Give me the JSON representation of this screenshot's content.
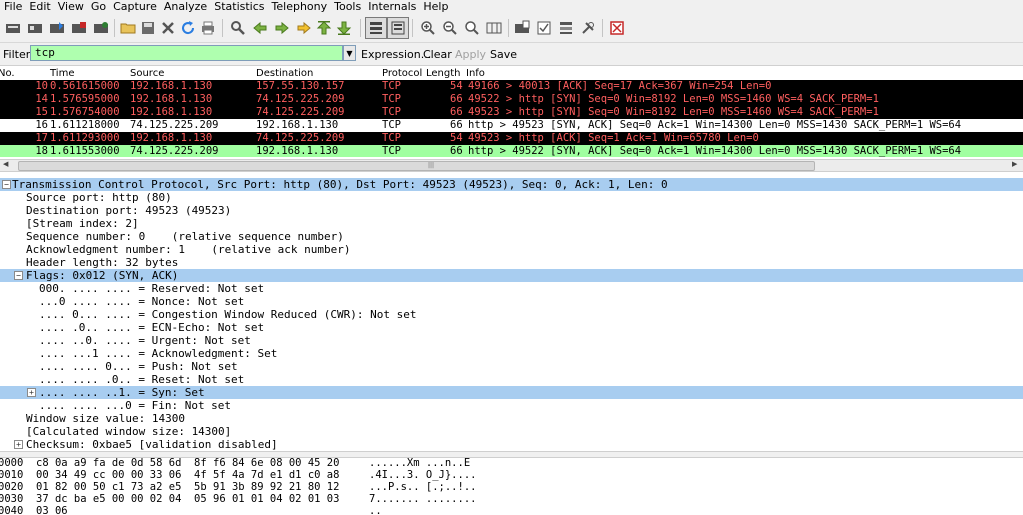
{
  "menu": [
    "File",
    "Edit",
    "View",
    "Go",
    "Capture",
    "Analyze",
    "Statistics",
    "Telephony",
    "Tools",
    "Internals",
    "Help"
  ],
  "filter": {
    "label": "Filter:",
    "value": "tcp",
    "expression": "Expression...",
    "clear": "Clear",
    "apply": "Apply",
    "save": "Save"
  },
  "columns": {
    "no": "No.",
    "time": "Time",
    "source": "Source",
    "destination": "Destination",
    "protocol": "Protocol",
    "length": "Length",
    "info": "Info"
  },
  "colors": {
    "black_row_bg": "#000000",
    "black_row_fg": "#ff5f5f",
    "white_row_bg": "#ffffff",
    "green_row_bg": "#a0ffa0",
    "selected_bg": "#a8cdf0",
    "filter_bg": "#afffaf"
  },
  "packets": [
    {
      "no": "10",
      "time": "0.561615000",
      "source": "192.168.1.130",
      "destination": "157.55.130.157",
      "protocol": "TCP",
      "length": "54",
      "info": "49166 > 40013 [ACK] Seq=17 Ack=367 Win=254 Len=0",
      "style": "black"
    },
    {
      "no": "14",
      "time": "1.576595000",
      "source": "192.168.1.130",
      "destination": "74.125.225.209",
      "protocol": "TCP",
      "length": "66",
      "info": "49522 > http [SYN] Seq=0 Win=8192 Len=0 MSS=1460 WS=4 SACK_PERM=1",
      "style": "black"
    },
    {
      "no": "15",
      "time": "1.576754000",
      "source": "192.168.1.130",
      "destination": "74.125.225.209",
      "protocol": "TCP",
      "length": "66",
      "info": "49523 > http [SYN] Seq=0 Win=8192 Len=0 MSS=1460 WS=4 SACK_PERM=1",
      "style": "black"
    },
    {
      "no": "16",
      "time": "1.611218000",
      "source": "74.125.225.209",
      "destination": "192.168.1.130",
      "protocol": "TCP",
      "length": "66",
      "info": "http > 49523 [SYN, ACK] Seq=0 Ack=1 Win=14300 Len=0 MSS=1430 SACK_PERM=1 WS=64",
      "style": "white"
    },
    {
      "no": "17",
      "time": "1.611293000",
      "source": "192.168.1.130",
      "destination": "74.125.225.209",
      "protocol": "TCP",
      "length": "54",
      "info": "49523 > http [ACK] Seq=1 Ack=1 Win=65780 Len=0",
      "style": "black"
    },
    {
      "no": "18",
      "time": "1.611553000",
      "source": "74.125.225.209",
      "destination": "192.168.1.130",
      "protocol": "TCP",
      "length": "66",
      "info": "http > 49522 [SYN, ACK] Seq=0 Ack=1 Win=14300 Len=0 MSS=1430 SACK_PERM=1 WS=64",
      "style": "green"
    }
  ],
  "details": [
    {
      "indent": 0,
      "expander": "minus",
      "text": "Transmission Control Protocol, Src Port: http (80), Dst Port: 49523 (49523), Seq: 0, Ack: 1, Len: 0",
      "style": "sel"
    },
    {
      "indent": 1,
      "expander": "",
      "text": "Source port: http (80)",
      "style": ""
    },
    {
      "indent": 1,
      "expander": "",
      "text": "Destination port: 49523 (49523)",
      "style": ""
    },
    {
      "indent": 1,
      "expander": "",
      "text": "[Stream index: 2]",
      "style": ""
    },
    {
      "indent": 1,
      "expander": "",
      "text": "Sequence number: 0    (relative sequence number)",
      "style": ""
    },
    {
      "indent": 1,
      "expander": "",
      "text": "Acknowledgment number: 1    (relative ack number)",
      "style": ""
    },
    {
      "indent": 1,
      "expander": "",
      "text": "Header length: 32 bytes",
      "style": ""
    },
    {
      "indent": 1,
      "expander": "minus",
      "text": "Flags: 0x012 (SYN, ACK)",
      "style": "sel"
    },
    {
      "indent": 2,
      "expander": "",
      "text": "000. .... .... = Reserved: Not set",
      "style": ""
    },
    {
      "indent": 2,
      "expander": "",
      "text": "...0 .... .... = Nonce: Not set",
      "style": ""
    },
    {
      "indent": 2,
      "expander": "",
      "text": ".... 0... .... = Congestion Window Reduced (CWR): Not set",
      "style": ""
    },
    {
      "indent": 2,
      "expander": "",
      "text": ".... .0.. .... = ECN-Echo: Not set",
      "style": ""
    },
    {
      "indent": 2,
      "expander": "",
      "text": ".... ..0. .... = Urgent: Not set",
      "style": ""
    },
    {
      "indent": 2,
      "expander": "",
      "text": ".... ...1 .... = Acknowledgment: Set",
      "style": ""
    },
    {
      "indent": 2,
      "expander": "",
      "text": ".... .... 0... = Push: Not set",
      "style": ""
    },
    {
      "indent": 2,
      "expander": "",
      "text": ".... .... .0.. = Reset: Not set",
      "style": ""
    },
    {
      "indent": 2,
      "expander": "plus",
      "text": ".... .... ..1. = Syn: Set",
      "style": "sel"
    },
    {
      "indent": 2,
      "expander": "",
      "text": ".... .... ...0 = Fin: Not set",
      "style": ""
    },
    {
      "indent": 1,
      "expander": "",
      "text": "Window size value: 14300",
      "style": ""
    },
    {
      "indent": 1,
      "expander": "",
      "text": "[Calculated window size: 14300]",
      "style": ""
    },
    {
      "indent": 1,
      "expander": "plus",
      "text": "Checksum: 0xbae5 [validation disabled]",
      "style": ""
    }
  ],
  "hex": [
    {
      "offset": "0000",
      "bytes": "c8 0a a9 fa de 0d 58 6d  8f f6 84 6e 08 00 45 20",
      "ascii": "......Xm ...n..E "
    },
    {
      "offset": "0010",
      "bytes": "00 34 49 cc 00 00 33 06  4f 5f 4a 7d e1 d1 c0 a8",
      "ascii": ".4I...3. O_J}...."
    },
    {
      "offset": "0020",
      "bytes": "01 82 00 50 c1 73 a2 e5  5b 91 3b 89 92 21 80 12",
      "ascii": "...P.s.. [.;..!.."
    },
    {
      "offset": "0030",
      "bytes": "37 dc ba e5 00 00 02 04  05 96 01 01 04 02 01 03",
      "ascii": "7....... ........"
    },
    {
      "offset": "0040",
      "bytes": "03 06",
      "ascii": ".."
    }
  ],
  "toolbar_icons": [
    "interface-list-icon",
    "capture-options-icon",
    "start-capture-icon",
    "stop-capture-icon",
    "restart-capture-icon",
    "open-file-icon",
    "save-file-icon",
    "close-file-icon",
    "reload-icon",
    "print-icon",
    "find-packet-icon",
    "go-back-icon",
    "go-forward-icon",
    "go-to-packet-icon",
    "go-first-icon",
    "go-last-icon",
    "colorize-icon",
    "auto-scroll-icon",
    "zoom-in-icon",
    "zoom-out-icon",
    "zoom-normal-icon",
    "resize-columns-icon",
    "capture-filters-icon",
    "display-filters-icon",
    "coloring-rules-icon",
    "preferences-icon",
    "help-icon"
  ]
}
